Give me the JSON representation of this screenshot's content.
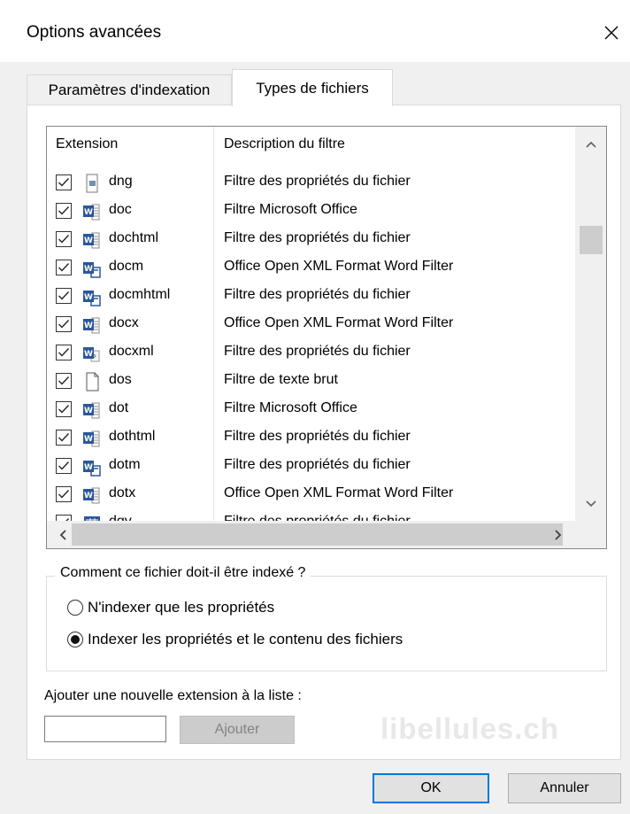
{
  "window": {
    "title": "Options avancées"
  },
  "tabs": [
    {
      "label": "Paramètres d'indexation"
    },
    {
      "label": "Types de fichiers"
    }
  ],
  "list": {
    "col_extension": "Extension",
    "col_description": "Description du filtre",
    "rows": [
      {
        "ext": "dng",
        "desc": "Filtre des propriétés du fichier",
        "checked": true,
        "icon": "generic-doc-icon"
      },
      {
        "ext": "doc",
        "desc": "Filtre Microsoft Office",
        "checked": true,
        "icon": "word-doc-icon"
      },
      {
        "ext": "dochtml",
        "desc": "Filtre des propriétés du fichier",
        "checked": true,
        "icon": "word-doc-icon"
      },
      {
        "ext": "docm",
        "desc": "Office Open XML Format Word Filter",
        "checked": true,
        "icon": "word-macro-icon"
      },
      {
        "ext": "docmhtml",
        "desc": "Filtre des propriétés du fichier",
        "checked": true,
        "icon": "word-macro-icon"
      },
      {
        "ext": "docx",
        "desc": "Office Open XML Format Word Filter",
        "checked": true,
        "icon": "word-doc-icon"
      },
      {
        "ext": "docxml",
        "desc": "Filtre des propriétés du fichier",
        "checked": true,
        "icon": "word-xml-icon"
      },
      {
        "ext": "dos",
        "desc": "Filtre de texte brut",
        "checked": true,
        "icon": "blank-file-icon"
      },
      {
        "ext": "dot",
        "desc": "Filtre Microsoft Office",
        "checked": true,
        "icon": "word-doc-icon"
      },
      {
        "ext": "dothtml",
        "desc": "Filtre des propriétés du fichier",
        "checked": true,
        "icon": "word-doc-icon"
      },
      {
        "ext": "dotm",
        "desc": "Filtre des propriétés du fichier",
        "checked": true,
        "icon": "word-macro-icon"
      },
      {
        "ext": "dotx",
        "desc": "Office Open XML Format Word Filter",
        "checked": true,
        "icon": "word-doc-icon"
      },
      {
        "ext": "dqy",
        "desc": "Filtre des propriétés du fichier",
        "checked": true,
        "icon": "excel-query-icon"
      }
    ]
  },
  "index_group": {
    "legend": "Comment ce fichier doit-il être indexé ?",
    "option_properties": "N'indexer que les propriétés",
    "option_content": "Indexer les propriétés et le contenu des fichiers",
    "selected": "option_content"
  },
  "add_extension": {
    "label": "Ajouter une nouvelle extension à la liste :",
    "value": "",
    "button": "Ajouter"
  },
  "watermark": "libellules.ch",
  "buttons": {
    "ok": "OK",
    "cancel": "Annuler"
  },
  "colors": {
    "accent": "#0078d7",
    "word_blue": "#2b579a"
  }
}
